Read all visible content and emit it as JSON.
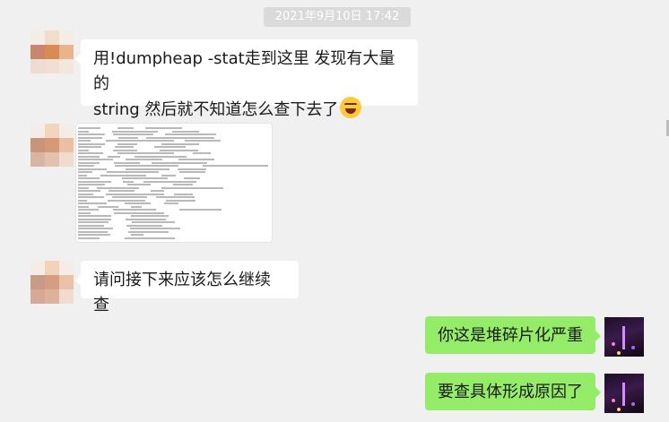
{
  "chat": {
    "timestamp": "2021年9月10日 17:42",
    "messages": [
      {
        "side": "incoming",
        "type": "text",
        "line1": "用!dumpheap -stat走到这里 发现有大量的",
        "line2": "string 然后就不知道怎么查下去了",
        "emoji": "tears-of-joy-emoji"
      },
      {
        "side": "incoming",
        "type": "image",
        "image": "memory-dump-screenshot"
      },
      {
        "side": "incoming",
        "type": "text",
        "text": "请问接下来应该怎么继续查"
      },
      {
        "side": "outgoing",
        "type": "text",
        "text": "你这是堆碎片化严重"
      },
      {
        "side": "outgoing",
        "type": "text",
        "text": "要查具体形成原因了"
      }
    ]
  },
  "colors": {
    "background": "#f0f0f0",
    "incoming_bubble": "#ffffff",
    "outgoing_bubble": "#95ec69",
    "timestamp_bg": "#dadada"
  }
}
